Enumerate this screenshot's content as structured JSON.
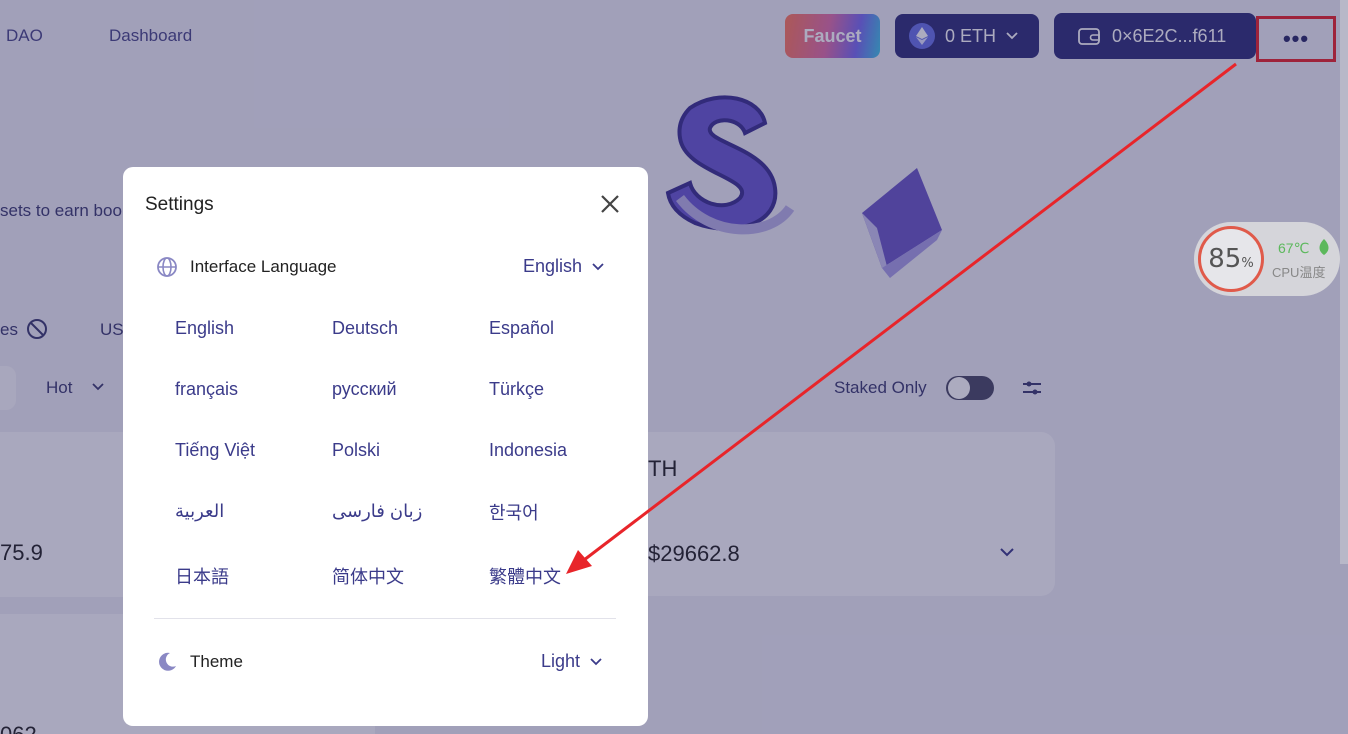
{
  "nav": {
    "dao": "DAO",
    "dashboard": "Dashboard"
  },
  "header": {
    "faucet": "Faucet",
    "eth_balance": "0 ETH",
    "wallet_address": "0×6E2C...f611",
    "more": "•••"
  },
  "background": {
    "earn_text": "sets to earn boo",
    "filter_es": "es",
    "filter_us": "US",
    "sort_hot": "Hot",
    "staked_only": "Staked Only",
    "card1_value": "75.9",
    "card2_symbol": "TH",
    "card2_value": "$29662.8",
    "card3_value": "062"
  },
  "cpu_widget": {
    "usage": "85",
    "unit": "%",
    "temp": "67℃",
    "label": "CPU温度"
  },
  "settings": {
    "title": "Settings",
    "interface_language_label": "Interface Language",
    "interface_language_value": "English",
    "languages": [
      "English",
      "Deutsch",
      "Español",
      "français",
      "русский",
      "Türkçe",
      "Tiếng Việt",
      "Polski",
      "Indonesia",
      "العربية",
      "زبان فارسی",
      "한국어",
      "日本語",
      "简体中文",
      "繁體中文"
    ],
    "theme_label": "Theme",
    "theme_value": "Light"
  },
  "colors": {
    "accent": "#3b3b8a",
    "annotation_red": "#e8252a",
    "nav_dark": "#2f2f7a"
  }
}
